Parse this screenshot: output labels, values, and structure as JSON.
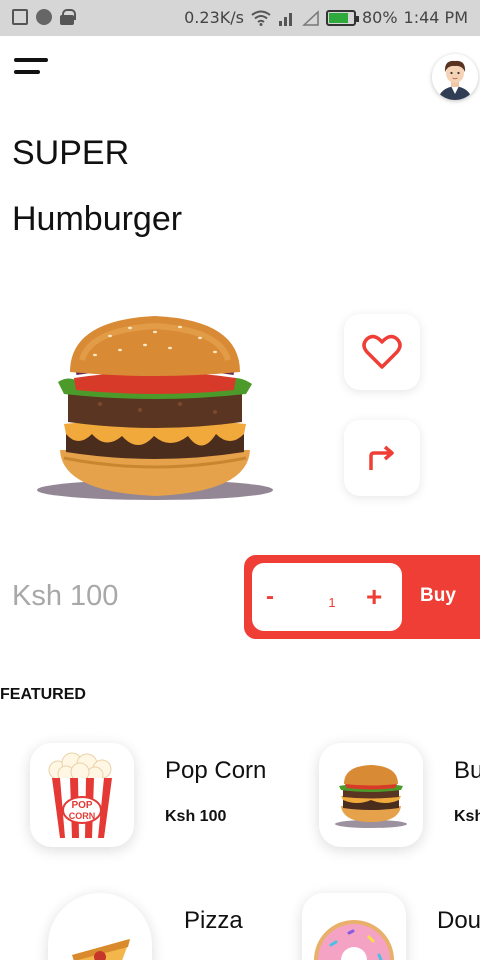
{
  "status_bar": {
    "network_speed": "0.23K/s",
    "battery": "80%",
    "time": "1:44 PM"
  },
  "product": {
    "title_line1": "SUPER",
    "title_line2": "Humburger",
    "price": "Ksh 100",
    "quantity": "1"
  },
  "cart": {
    "minus_label": "-",
    "plus_label": "+",
    "buy_label": "Buy"
  },
  "featured": {
    "heading": "FEATURED",
    "items": [
      {
        "name": "Pop Corn",
        "price": "Ksh 100"
      },
      {
        "name": "Bu",
        "price": "Ksh"
      },
      {
        "name": "Pizza",
        "price": ""
      },
      {
        "name": "Dou",
        "price": ""
      }
    ]
  },
  "popcorn_logo_text": [
    "POP",
    "CORN"
  ],
  "colors": {
    "accent": "#ef3e36",
    "price_text": "#a8a8a8",
    "status_bar": "#d6d6d6"
  },
  "icons": [
    "menu-icon",
    "avatar",
    "heart-icon",
    "share-arrow-icon"
  ]
}
